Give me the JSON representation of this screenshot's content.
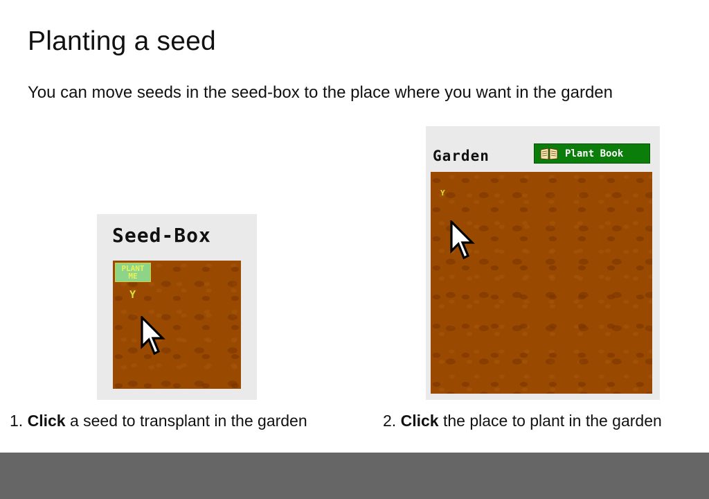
{
  "slide": {
    "title": "Planting a seed",
    "subtitle": "You can move seeds in the seed-box to the place where you want in the garden"
  },
  "seedbox": {
    "heading": "Seed-Box",
    "plant_me_line1": "PLANT",
    "plant_me_line2": "ME",
    "sprout_glyph": "Y"
  },
  "garden": {
    "heading": "Garden",
    "plant_book_label": "Plant Book",
    "sprout_glyph": "Y"
  },
  "steps": [
    {
      "number": "1.",
      "action": "Click",
      "rest": " a seed to transplant in the garden"
    },
    {
      "number": "2.",
      "action": "Click",
      "rest": " the place to plant in the garden"
    }
  ],
  "colors": {
    "soil": "#994a00",
    "panel": "#eaeaea",
    "plant_book_button": "#0a7d0a",
    "footer": "#666666",
    "sprout": "#d6e23a"
  },
  "icons": {
    "cursor": "arrow-cursor-icon",
    "book": "open-book-icon",
    "sprout": "sprout-icon"
  }
}
